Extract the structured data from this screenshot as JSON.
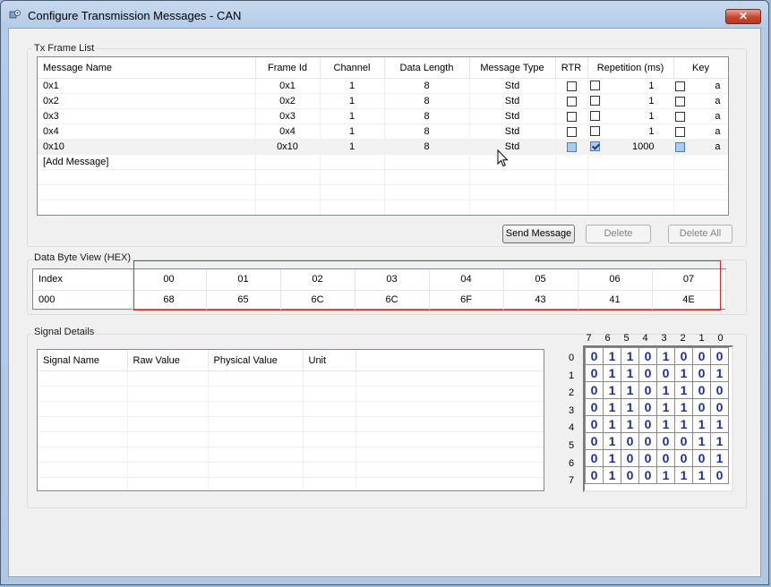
{
  "window": {
    "title": "Configure Transmission Messages - CAN",
    "close_label": "✕"
  },
  "tx_frame_list": {
    "label": "Tx Frame List",
    "columns": [
      "Message Name",
      "Frame Id",
      "Channel",
      "Data Length",
      "Message Type",
      "RTR",
      "Repetition (ms)",
      "Key"
    ],
    "rows": [
      {
        "name": "0x1",
        "frame_id": "0x1",
        "channel": "1",
        "dlc": "8",
        "type": "Std",
        "rtr": false,
        "rep_checked": false,
        "repetition": "1",
        "key_checked": false,
        "key": "a",
        "selected": false
      },
      {
        "name": "0x2",
        "frame_id": "0x2",
        "channel": "1",
        "dlc": "8",
        "type": "Std",
        "rtr": false,
        "rep_checked": false,
        "repetition": "1",
        "key_checked": false,
        "key": "a",
        "selected": false
      },
      {
        "name": "0x3",
        "frame_id": "0x3",
        "channel": "1",
        "dlc": "8",
        "type": "Std",
        "rtr": false,
        "rep_checked": false,
        "repetition": "1",
        "key_checked": false,
        "key": "a",
        "selected": false
      },
      {
        "name": "0x4",
        "frame_id": "0x4",
        "channel": "1",
        "dlc": "8",
        "type": "Std",
        "rtr": false,
        "rep_checked": false,
        "repetition": "1",
        "key_checked": false,
        "key": "a",
        "selected": false
      },
      {
        "name": "0x10",
        "frame_id": "0x10",
        "channel": "1",
        "dlc": "8",
        "type": "Std",
        "rtr": false,
        "rep_checked": true,
        "repetition": "1000",
        "key_checked": false,
        "key": "a",
        "selected": true
      }
    ],
    "add_message": "[Add Message]"
  },
  "buttons": {
    "send": "Send Message",
    "delete": "Delete",
    "delete_all": "Delete All"
  },
  "data_byte_view": {
    "label": "Data Byte View (HEX)",
    "index_label": "Index",
    "headers": [
      "00",
      "01",
      "02",
      "03",
      "04",
      "05",
      "06",
      "07"
    ],
    "row_index": "000",
    "values": [
      "68",
      "65",
      "6C",
      "6C",
      "6F",
      "43",
      "41",
      "4E"
    ]
  },
  "signal_details": {
    "label": "Signal Details",
    "columns": [
      "Signal Name",
      "Raw Value",
      "Physical Value",
      "Unit"
    ]
  },
  "bit_view": {
    "col_headers": [
      "7",
      "6",
      "5",
      "4",
      "3",
      "2",
      "1",
      "0"
    ],
    "row_headers": [
      "0",
      "1",
      "2",
      "3",
      "4",
      "5",
      "6",
      "7"
    ],
    "bits": [
      [
        "0",
        "1",
        "1",
        "0",
        "1",
        "0",
        "0",
        "0"
      ],
      [
        "0",
        "1",
        "1",
        "0",
        "0",
        "1",
        "0",
        "1"
      ],
      [
        "0",
        "1",
        "1",
        "0",
        "1",
        "1",
        "0",
        "0"
      ],
      [
        "0",
        "1",
        "1",
        "0",
        "1",
        "1",
        "0",
        "0"
      ],
      [
        "0",
        "1",
        "1",
        "0",
        "1",
        "1",
        "1",
        "1"
      ],
      [
        "0",
        "1",
        "0",
        "0",
        "0",
        "0",
        "1",
        "1"
      ],
      [
        "0",
        "1",
        "0",
        "0",
        "0",
        "0",
        "0",
        "1"
      ],
      [
        "0",
        "1",
        "0",
        "0",
        "1",
        "1",
        "1",
        "0"
      ]
    ]
  }
}
